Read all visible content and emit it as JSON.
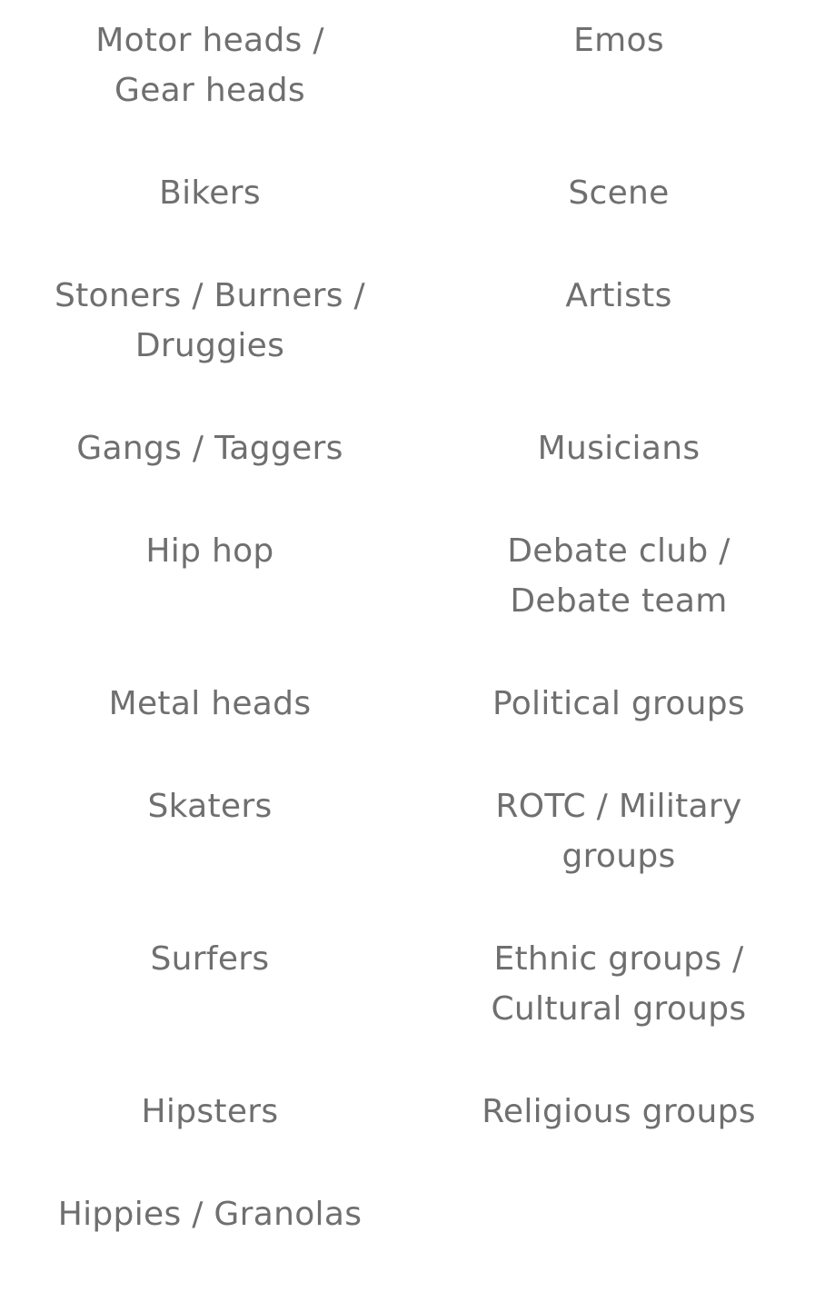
{
  "left_column": [
    "Motor heads /\nGear heads",
    "Bikers",
    "Stoners / Burners /\nDruggies",
    "Gangs / Taggers",
    "Hip hop",
    "Metal heads",
    "Skaters",
    "Surfers",
    "Hipsters",
    "Hippies / Granolas"
  ],
  "right_column": [
    "Emos",
    "Scene",
    "Artists",
    "Musicians",
    "Debate club /\nDebate team",
    "Political groups",
    "ROTC / Military\ngroups",
    "Ethnic groups /\nCultural groups",
    "Religious groups"
  ]
}
